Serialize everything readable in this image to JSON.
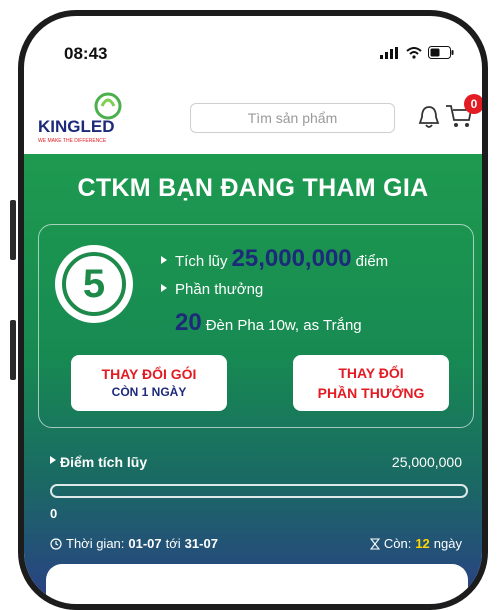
{
  "status_bar": {
    "time": "08:43"
  },
  "header": {
    "logo_text": "KINGLED",
    "logo_slogan": "WE MAKE THE DIFFERENCE",
    "search_placeholder": "Tìm sản phẩm",
    "cart_badge": "0"
  },
  "promo": {
    "title": "CTKM BẠN ĐANG THAM GIA",
    "level": "5",
    "accumulate_label": "Tích lũy",
    "accumulate_value": "25,000,000",
    "accumulate_unit": "điểm",
    "reward_label": "Phần thưởng",
    "reward_qty": "20",
    "reward_item": "Đèn Pha 10w, as Trắng",
    "btn_change_package_line1": "THAY ĐỔI GÓI",
    "btn_change_package_line2": "CÒN 1 NGÀY",
    "btn_change_reward_line1": "THAY ĐỔI",
    "btn_change_reward_line2": "PHẦN THƯỞNG"
  },
  "points": {
    "label": "Điểm tích lũy",
    "total": "25,000,000",
    "current": "0",
    "progress_fraction": 0
  },
  "period": {
    "time_label": "Thời gian:",
    "start": "01-07",
    "to_word": "tới",
    "end": "31-07",
    "remaining_label": "Còn:",
    "remaining_value": "12",
    "remaining_unit": "ngày"
  },
  "colors": {
    "brand_green": "#1e9a4f",
    "navy": "#1d2a7a",
    "accent_red": "#e31b23",
    "highlight_yellow": "#ffd400"
  }
}
